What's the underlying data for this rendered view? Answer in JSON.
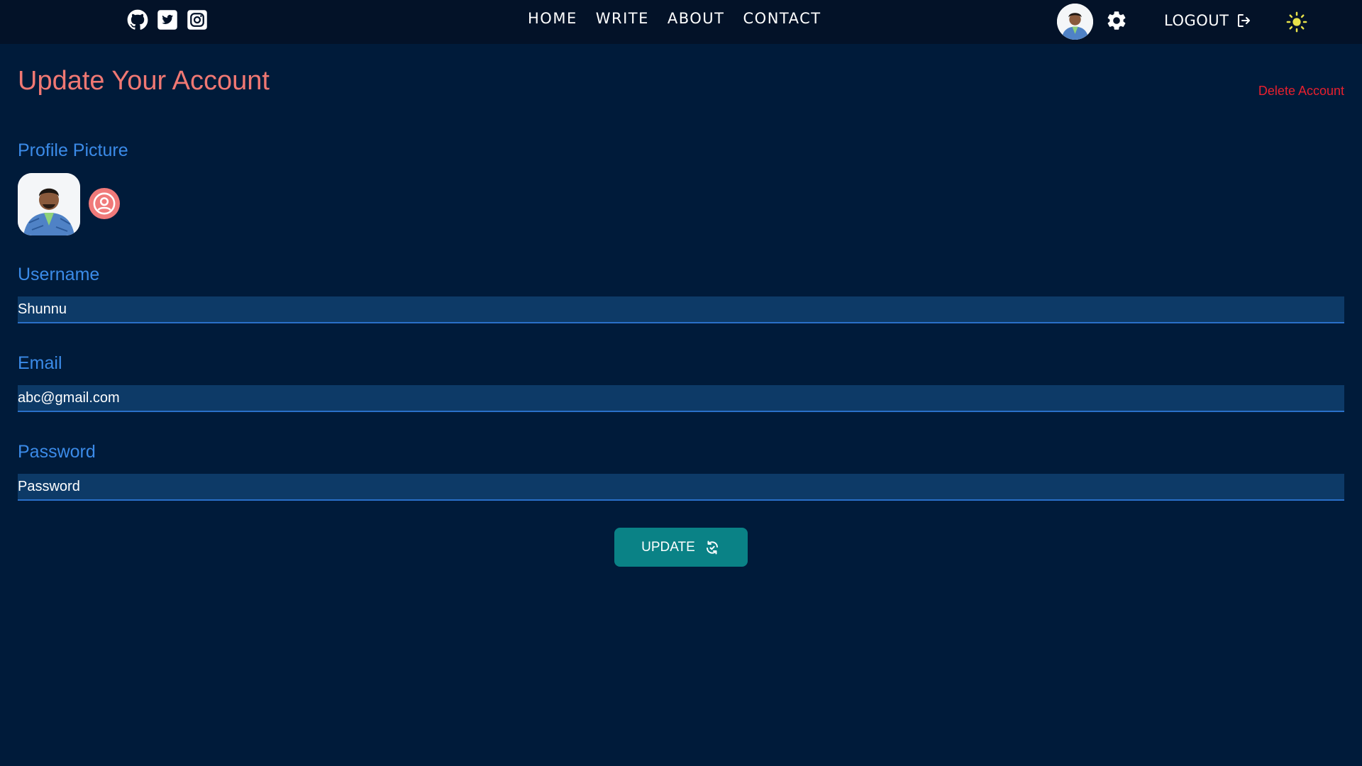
{
  "header": {
    "social_icons": [
      "github-icon",
      "twitter-icon",
      "instagram-icon"
    ],
    "nav": [
      "HOME",
      "WRITE",
      "ABOUT",
      "CONTACT"
    ],
    "logout_label": "LOGOUT",
    "settings_icon": "gear-icon",
    "theme_icon": "sun-icon"
  },
  "page": {
    "title": "Update Your Account",
    "delete_label": "Delete Account"
  },
  "form": {
    "profile_picture_label": "Profile Picture",
    "username_label": "Username",
    "username_value": "Shunnu",
    "email_label": "Email",
    "email_value": "abc@gmail.com",
    "password_label": "Password",
    "password_placeholder": "Password",
    "update_label": "UPDATE"
  },
  "colors": {
    "background": "#001b3a",
    "topbar": "#031228",
    "title": "#f07873",
    "labels": "#3b8be8",
    "delete": "#e8202e",
    "button": "#0a8286",
    "sun": "#e8e24a"
  }
}
